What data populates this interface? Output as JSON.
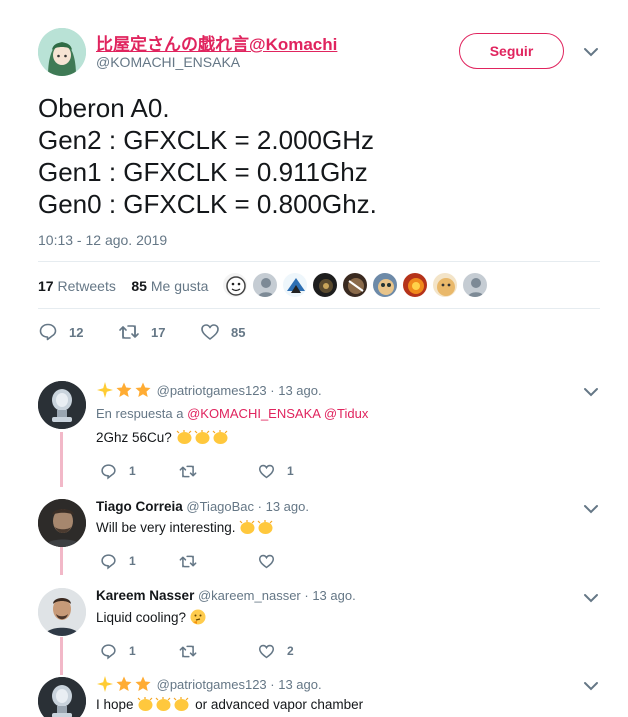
{
  "tweet": {
    "author_name": "比屋定さんの戯れ言@Komachi",
    "author_handle": "@KOMACHI_ENSAKA",
    "follow_label": "Seguir",
    "lines": [
      "Oberon A0.",
      "Gen2 : GFXCLK = 2.000GHz",
      "Gen1 : GFXCLK = 0.911Ghz",
      "Gen0 : GFXCLK = 0.800Ghz."
    ],
    "timestamp": "10:13 - 12 ago. 2019",
    "retweets_count": "17",
    "retweets_label": "Retweets",
    "likes_count": "85",
    "likes_label": "Me gusta",
    "reply_count": "12",
    "retweet_count": "17",
    "like_count": "85"
  },
  "replies": [
    {
      "handle": "@patriotgames123",
      "date": "· 13 ago.",
      "in_reply_prefix": "En respuesta a",
      "in_reply_mention1": "@KOMACHI_ENSAKA",
      "in_reply_mention2": "@Tidux",
      "text": "2Ghz 56Cu?",
      "reply_count": "1",
      "retweet_count": "",
      "like_count": "1"
    },
    {
      "name": "Tiago Correia",
      "handle": "@TiagoBac",
      "date": "· 13 ago.",
      "text": "Will be very interesting.",
      "reply_count": "1",
      "retweet_count": "",
      "like_count": ""
    },
    {
      "name": "Kareem Nasser",
      "handle": "@kareem_nasser",
      "date": "· 13 ago.",
      "text": "Liquid cooling?",
      "reply_count": "1",
      "retweet_count": "",
      "like_count": "2"
    },
    {
      "handle": "@patriotgames123",
      "date": "· 13 ago.",
      "text_before": "I hope",
      "text_after": "or advanced vapor chamber"
    }
  ],
  "colors": {
    "accent": "#e0245e",
    "muted": "#657786",
    "text": "#14171a",
    "thread": "#f2b8c8"
  }
}
